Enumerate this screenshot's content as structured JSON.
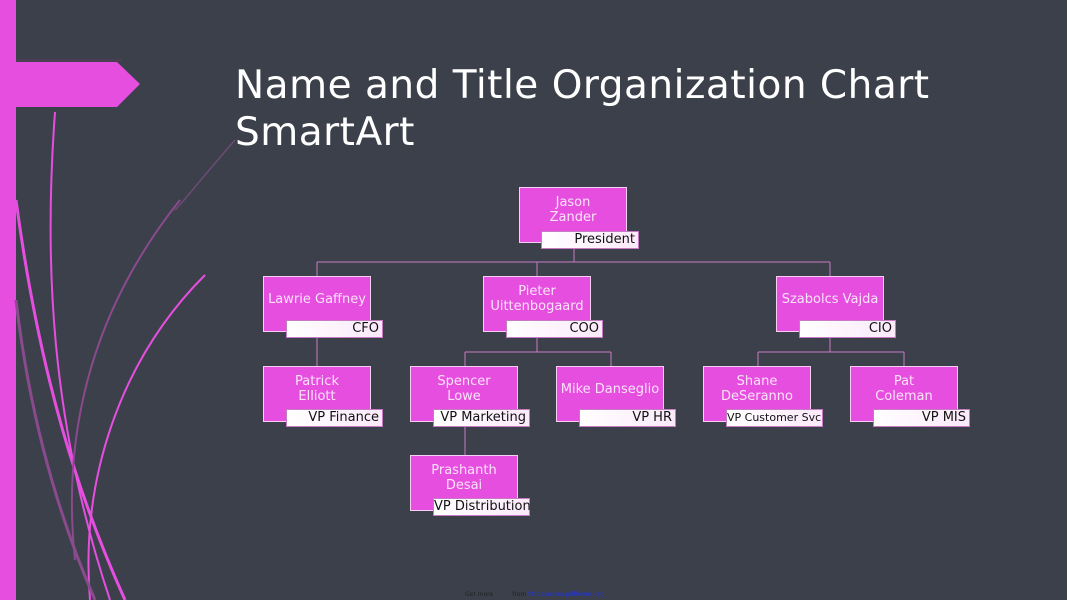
{
  "slide": {
    "title_line1": "Name and Title Organization Chart",
    "title_line2": "SmartArt",
    "accent_color": "#e64ee0",
    "background_color": "#3b404a"
  },
  "org_chart": {
    "president": {
      "name": "Jason Zander",
      "title": "President"
    },
    "level1": [
      {
        "name": "Lawrie Gaffney",
        "title": "CFO"
      },
      {
        "name": "Pieter Uittenbogaard",
        "title": "COO"
      },
      {
        "name": "Szabolcs Vajda",
        "title": "CIO"
      }
    ],
    "cfo_reports": [
      {
        "name": "Patrick Elliott",
        "title": "VP Finance"
      }
    ],
    "coo_reports": [
      {
        "name": "Spencer Lowe",
        "title": "VP Marketing"
      },
      {
        "name": "Mike Danseglio",
        "title": "VP HR"
      }
    ],
    "marketing_reports": [
      {
        "name": "Prashanth Desai",
        "title": "VP Distribution"
      }
    ],
    "cio_reports": [
      {
        "name": "Shane DeSeranno",
        "title": "VP Customer Svc"
      },
      {
        "name": "Pat Coleman",
        "title": "VP MIS"
      }
    ]
  },
  "footer": {
    "get_more": "Get more",
    "from": "from",
    "link": "https://www.pdfforms.org"
  }
}
